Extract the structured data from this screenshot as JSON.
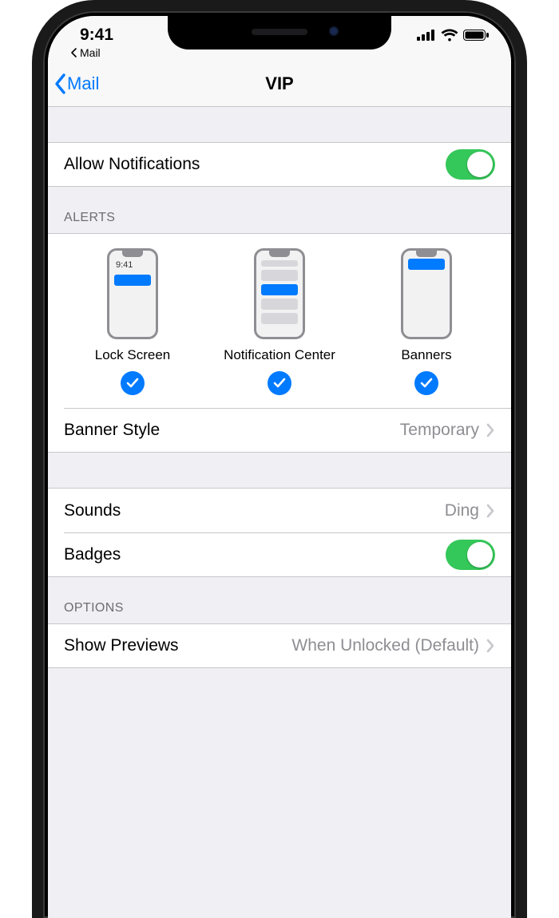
{
  "status": {
    "time": "9:41",
    "breadcrumb_app": "Mail"
  },
  "nav": {
    "back_label": "Mail",
    "title": "VIP"
  },
  "rows": {
    "allow_notifications_label": "Allow Notifications",
    "banner_style_label": "Banner Style",
    "banner_style_value": "Temporary",
    "sounds_label": "Sounds",
    "sounds_value": "Ding",
    "badges_label": "Badges",
    "show_previews_label": "Show Previews",
    "show_previews_value": "When Unlocked (Default)"
  },
  "sections": {
    "alerts_header": "ALERTS",
    "options_header": "OPTIONS"
  },
  "alerts": {
    "lock_screen_label": "Lock Screen",
    "lock_screen_time": "9:41",
    "nc_label": "Notification Center",
    "banners_label": "Banners"
  },
  "toggles": {
    "allow_notifications": "on",
    "badges": "on"
  },
  "alert_selections": {
    "lock_screen": true,
    "notification_center": true,
    "banners": true
  },
  "colors": {
    "tint": "#007aff",
    "toggle_on": "#34c759",
    "secondary": "#8e8e93",
    "group_bg": "#efeff4"
  }
}
